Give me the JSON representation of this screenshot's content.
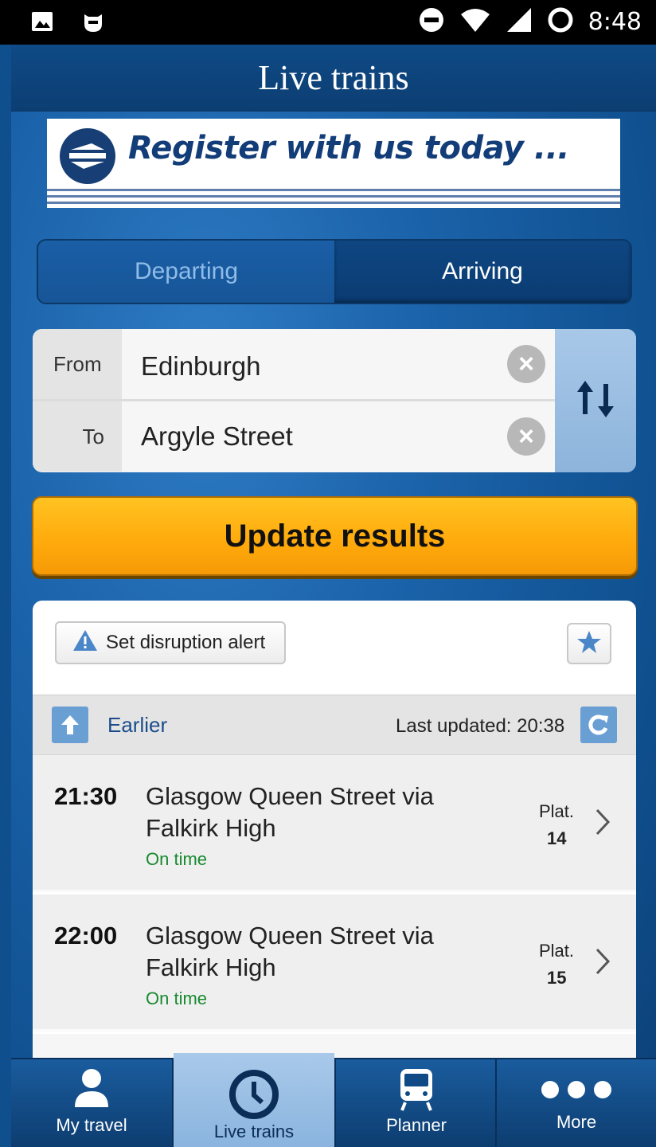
{
  "status_bar": {
    "time": "8:48",
    "left_icons": [
      "image-icon",
      "cat-face-icon"
    ],
    "right_icons": [
      "do-not-disturb-icon",
      "wifi-icon",
      "signal-icon",
      "battery-icon"
    ]
  },
  "header": {
    "title": "Live trains"
  },
  "banner": {
    "text": "Register with us today ..."
  },
  "segment": {
    "departing_label": "Departing",
    "arriving_label": "Arriving",
    "selected": "Arriving"
  },
  "route": {
    "from_label": "From",
    "from_value": "Edinburgh",
    "to_label": "To",
    "to_value": "Argyle Street"
  },
  "update_button": {
    "label": "Update results"
  },
  "results": {
    "alert_button_label": "Set disruption alert",
    "earlier_label": "Earlier",
    "last_updated": "Last updated: 20:38",
    "trains": [
      {
        "time": "21:30",
        "destination": "Glasgow Queen Street via Falkirk High",
        "status": "On time",
        "platform_label": "Plat.",
        "platform": "14"
      },
      {
        "time": "22:00",
        "destination": "Glasgow Queen Street via Falkirk High",
        "status": "On time",
        "platform_label": "Plat.",
        "platform": "15"
      }
    ]
  },
  "bottom_nav": {
    "items": [
      {
        "label": "My travel",
        "icon": "person-icon"
      },
      {
        "label": "Live trains",
        "icon": "clock-icon",
        "active": true
      },
      {
        "label": "Planner",
        "icon": "train-icon"
      },
      {
        "label": "More",
        "icon": "more-dots-icon"
      }
    ]
  },
  "colors": {
    "primary_blue": "#0f4f8e",
    "accent_yellow": "#ffab0d",
    "on_time_green": "#178a2f"
  }
}
